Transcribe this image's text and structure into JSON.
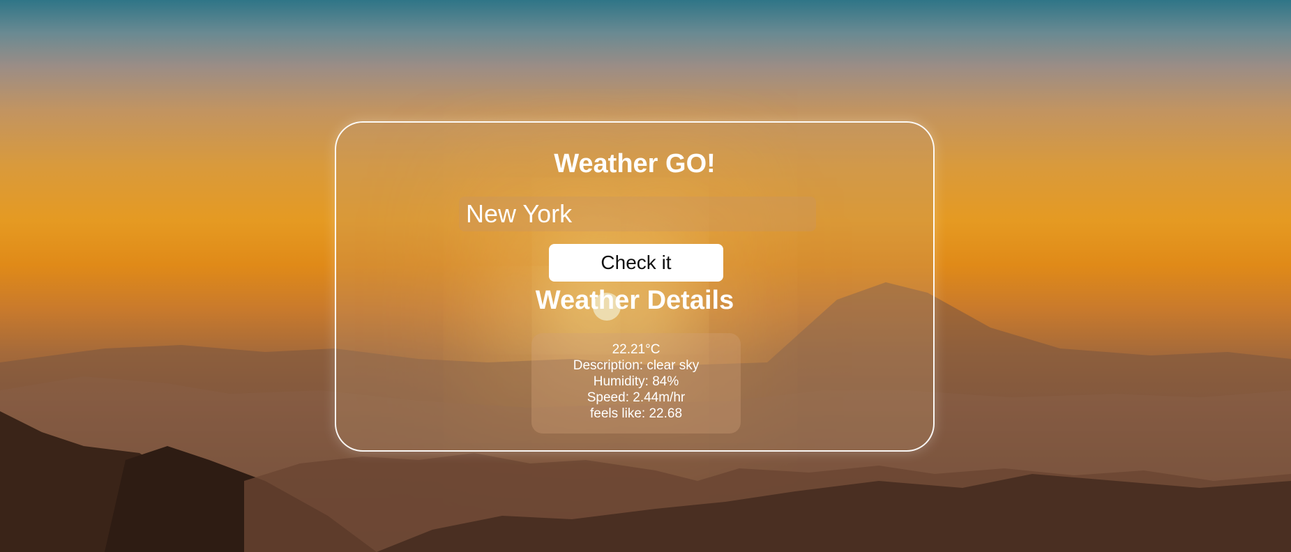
{
  "app": {
    "title": "Weather GO!"
  },
  "search": {
    "value": "New York",
    "button_label": "Check it"
  },
  "details": {
    "heading": "Weather Details",
    "temperature": "22.21°C",
    "description": "Description: clear sky",
    "humidity": "Humidity: 84%",
    "speed": "Speed: 2.44m/hr",
    "feels_like": "feels like: 22.68"
  },
  "colors": {
    "card_border": "#ffffff",
    "button_bg": "#ffffff",
    "text": "#ffffff"
  }
}
